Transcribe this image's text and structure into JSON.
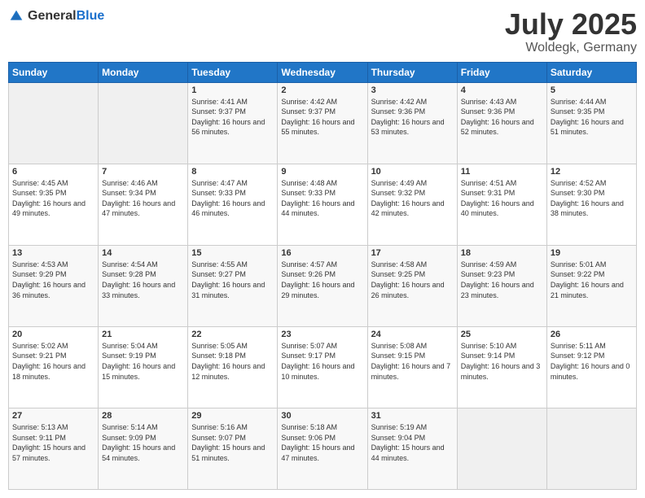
{
  "logo": {
    "general": "General",
    "blue": "Blue"
  },
  "header": {
    "month": "July 2025",
    "location": "Woldegk, Germany"
  },
  "weekdays": [
    "Sunday",
    "Monday",
    "Tuesday",
    "Wednesday",
    "Thursday",
    "Friday",
    "Saturday"
  ],
  "weeks": [
    [
      {
        "day": "",
        "sunrise": "",
        "sunset": "",
        "daylight": ""
      },
      {
        "day": "",
        "sunrise": "",
        "sunset": "",
        "daylight": ""
      },
      {
        "day": "1",
        "sunrise": "Sunrise: 4:41 AM",
        "sunset": "Sunset: 9:37 PM",
        "daylight": "Daylight: 16 hours and 56 minutes."
      },
      {
        "day": "2",
        "sunrise": "Sunrise: 4:42 AM",
        "sunset": "Sunset: 9:37 PM",
        "daylight": "Daylight: 16 hours and 55 minutes."
      },
      {
        "day": "3",
        "sunrise": "Sunrise: 4:42 AM",
        "sunset": "Sunset: 9:36 PM",
        "daylight": "Daylight: 16 hours and 53 minutes."
      },
      {
        "day": "4",
        "sunrise": "Sunrise: 4:43 AM",
        "sunset": "Sunset: 9:36 PM",
        "daylight": "Daylight: 16 hours and 52 minutes."
      },
      {
        "day": "5",
        "sunrise": "Sunrise: 4:44 AM",
        "sunset": "Sunset: 9:35 PM",
        "daylight": "Daylight: 16 hours and 51 minutes."
      }
    ],
    [
      {
        "day": "6",
        "sunrise": "Sunrise: 4:45 AM",
        "sunset": "Sunset: 9:35 PM",
        "daylight": "Daylight: 16 hours and 49 minutes."
      },
      {
        "day": "7",
        "sunrise": "Sunrise: 4:46 AM",
        "sunset": "Sunset: 9:34 PM",
        "daylight": "Daylight: 16 hours and 47 minutes."
      },
      {
        "day": "8",
        "sunrise": "Sunrise: 4:47 AM",
        "sunset": "Sunset: 9:33 PM",
        "daylight": "Daylight: 16 hours and 46 minutes."
      },
      {
        "day": "9",
        "sunrise": "Sunrise: 4:48 AM",
        "sunset": "Sunset: 9:33 PM",
        "daylight": "Daylight: 16 hours and 44 minutes."
      },
      {
        "day": "10",
        "sunrise": "Sunrise: 4:49 AM",
        "sunset": "Sunset: 9:32 PM",
        "daylight": "Daylight: 16 hours and 42 minutes."
      },
      {
        "day": "11",
        "sunrise": "Sunrise: 4:51 AM",
        "sunset": "Sunset: 9:31 PM",
        "daylight": "Daylight: 16 hours and 40 minutes."
      },
      {
        "day": "12",
        "sunrise": "Sunrise: 4:52 AM",
        "sunset": "Sunset: 9:30 PM",
        "daylight": "Daylight: 16 hours and 38 minutes."
      }
    ],
    [
      {
        "day": "13",
        "sunrise": "Sunrise: 4:53 AM",
        "sunset": "Sunset: 9:29 PM",
        "daylight": "Daylight: 16 hours and 36 minutes."
      },
      {
        "day": "14",
        "sunrise": "Sunrise: 4:54 AM",
        "sunset": "Sunset: 9:28 PM",
        "daylight": "Daylight: 16 hours and 33 minutes."
      },
      {
        "day": "15",
        "sunrise": "Sunrise: 4:55 AM",
        "sunset": "Sunset: 9:27 PM",
        "daylight": "Daylight: 16 hours and 31 minutes."
      },
      {
        "day": "16",
        "sunrise": "Sunrise: 4:57 AM",
        "sunset": "Sunset: 9:26 PM",
        "daylight": "Daylight: 16 hours and 29 minutes."
      },
      {
        "day": "17",
        "sunrise": "Sunrise: 4:58 AM",
        "sunset": "Sunset: 9:25 PM",
        "daylight": "Daylight: 16 hours and 26 minutes."
      },
      {
        "day": "18",
        "sunrise": "Sunrise: 4:59 AM",
        "sunset": "Sunset: 9:23 PM",
        "daylight": "Daylight: 16 hours and 23 minutes."
      },
      {
        "day": "19",
        "sunrise": "Sunrise: 5:01 AM",
        "sunset": "Sunset: 9:22 PM",
        "daylight": "Daylight: 16 hours and 21 minutes."
      }
    ],
    [
      {
        "day": "20",
        "sunrise": "Sunrise: 5:02 AM",
        "sunset": "Sunset: 9:21 PM",
        "daylight": "Daylight: 16 hours and 18 minutes."
      },
      {
        "day": "21",
        "sunrise": "Sunrise: 5:04 AM",
        "sunset": "Sunset: 9:19 PM",
        "daylight": "Daylight: 16 hours and 15 minutes."
      },
      {
        "day": "22",
        "sunrise": "Sunrise: 5:05 AM",
        "sunset": "Sunset: 9:18 PM",
        "daylight": "Daylight: 16 hours and 12 minutes."
      },
      {
        "day": "23",
        "sunrise": "Sunrise: 5:07 AM",
        "sunset": "Sunset: 9:17 PM",
        "daylight": "Daylight: 16 hours and 10 minutes."
      },
      {
        "day": "24",
        "sunrise": "Sunrise: 5:08 AM",
        "sunset": "Sunset: 9:15 PM",
        "daylight": "Daylight: 16 hours and 7 minutes."
      },
      {
        "day": "25",
        "sunrise": "Sunrise: 5:10 AM",
        "sunset": "Sunset: 9:14 PM",
        "daylight": "Daylight: 16 hours and 3 minutes."
      },
      {
        "day": "26",
        "sunrise": "Sunrise: 5:11 AM",
        "sunset": "Sunset: 9:12 PM",
        "daylight": "Daylight: 16 hours and 0 minutes."
      }
    ],
    [
      {
        "day": "27",
        "sunrise": "Sunrise: 5:13 AM",
        "sunset": "Sunset: 9:11 PM",
        "daylight": "Daylight: 15 hours and 57 minutes."
      },
      {
        "day": "28",
        "sunrise": "Sunrise: 5:14 AM",
        "sunset": "Sunset: 9:09 PM",
        "daylight": "Daylight: 15 hours and 54 minutes."
      },
      {
        "day": "29",
        "sunrise": "Sunrise: 5:16 AM",
        "sunset": "Sunset: 9:07 PM",
        "daylight": "Daylight: 15 hours and 51 minutes."
      },
      {
        "day": "30",
        "sunrise": "Sunrise: 5:18 AM",
        "sunset": "Sunset: 9:06 PM",
        "daylight": "Daylight: 15 hours and 47 minutes."
      },
      {
        "day": "31",
        "sunrise": "Sunrise: 5:19 AM",
        "sunset": "Sunset: 9:04 PM",
        "daylight": "Daylight: 15 hours and 44 minutes."
      },
      {
        "day": "",
        "sunrise": "",
        "sunset": "",
        "daylight": ""
      },
      {
        "day": "",
        "sunrise": "",
        "sunset": "",
        "daylight": ""
      }
    ]
  ]
}
